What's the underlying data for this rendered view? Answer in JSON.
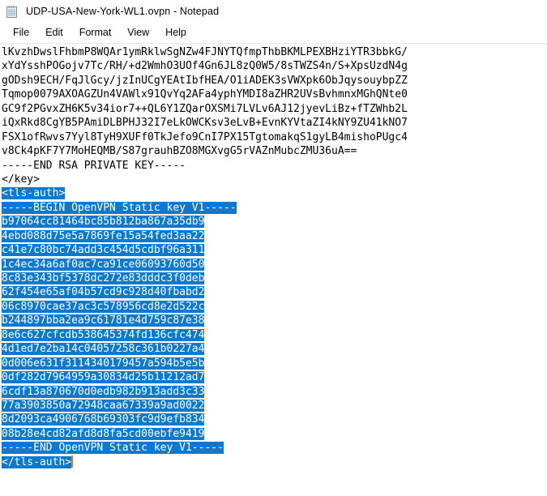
{
  "window": {
    "title": "UDP-USA-New-York-WL1.ovpn - Notepad",
    "icon": "notepad-icon",
    "background_color": "#ffffff"
  },
  "menu": {
    "items": [
      {
        "label": "File"
      },
      {
        "label": "Edit"
      },
      {
        "label": "Format"
      },
      {
        "label": "View"
      },
      {
        "label": "Help"
      }
    ]
  },
  "selection": {
    "highlight_color": "#0b79d0",
    "text_color": "#ffffff",
    "caret_color": "#e8792a"
  },
  "document": {
    "lines": [
      {
        "text": "lKvzhDwslFhbmP8WQAr1ymRklwSgNZw4FJNYTQfmpThbBKMLPEXBHziYTR3bbkG/",
        "selected": false
      },
      {
        "text": "xYdYsshPOGojv7Tc/RH/+d2WmhO3UOf4Gn6JL8zQ0W5/8sTWZS4n/S+XpsUzdN4g",
        "selected": false
      },
      {
        "text": "gODsh9ECH/FqJlGcy/jzInUCgYEAtIbfHEA/O1iADEK3sVWXpk6ObJqysouybpZZ",
        "selected": false
      },
      {
        "text": "Tqmop0079AXOAGZUn4VAWlx91QvYq2AFa4yphYMDI8aZHR2UVsBvhmnxMGhQNte0",
        "selected": false
      },
      {
        "text": "GC9f2PGvxZH6K5v34ior7++QL6Y1ZQarOXSMi7LVLv6AJ12jyevLiBz+fTZWhb2L",
        "selected": false
      },
      {
        "text": "iQxRkd8CgYB5PAmiDLBPHJ32I7eLkOWCKsv3eLvB+EvnKYVtaZI4kNY9ZU41kNO7",
        "selected": false
      },
      {
        "text": "FSX1ofRwvs7Yyl8TyH9XUFf0TkJefo9CnI7PX15TgtomakqS1gyLB4mishoPUgc4",
        "selected": false
      },
      {
        "text": "v8Ck4pKF7Y7MoHEQMB/S87grauhBZO8MGXvgG5rVAZnMubcZMU36uA==",
        "selected": false
      },
      {
        "text": "-----END RSA PRIVATE KEY-----",
        "selected": false
      },
      {
        "text": "</key>",
        "selected": false
      },
      {
        "text": "<tls-auth>",
        "selected": true
      },
      {
        "text": "-----BEGIN OpenVPN Static key V1-----",
        "selected": true
      },
      {
        "text": "b97064cc81464bc85b812ba867a35db9",
        "selected": true
      },
      {
        "text": "4ebd088d75e5a7869fe15a54fed3aa22",
        "selected": true
      },
      {
        "text": "c41e7c80bc74add3c454d5cdbf96a311",
        "selected": true
      },
      {
        "text": "1c4ec34a6af0ac7ca91ce06093760d50",
        "selected": true
      },
      {
        "text": "8c83e343bf5378dc272e83dddc3f0deb",
        "selected": true
      },
      {
        "text": "62f454e65af04b57cd9c928d40fbabd2",
        "selected": true
      },
      {
        "text": "06c8970cae37ac3c578956cd8e2d522c",
        "selected": true
      },
      {
        "text": "b244897bba2ea9c61781e4d759c87e38",
        "selected": true
      },
      {
        "text": "8e6c627cfcdb538645374fd136cfc474",
        "selected": true
      },
      {
        "text": "4d1ed7e2ba14c04057258c361b0227a4",
        "selected": true
      },
      {
        "text": "0d006e631f3114340179457a594b5e5b",
        "selected": true
      },
      {
        "text": "0df282d7964959a30834d25b11212ad7",
        "selected": true
      },
      {
        "text": "6cdf13a870670d0edb982b913add3c33",
        "selected": true
      },
      {
        "text": "77a3903850a72948caa67339a9ad0022",
        "selected": true
      },
      {
        "text": "8d2093ca4906768b69303fc9d9efb834",
        "selected": true
      },
      {
        "text": "08b28e4cd82afd8d8fa5cd00ebfe9419",
        "selected": true
      },
      {
        "text": "-----END OpenVPN Static key V1-----",
        "selected": true
      },
      {
        "text": "</tls-auth>",
        "selected": true,
        "caret_after": true
      }
    ]
  }
}
